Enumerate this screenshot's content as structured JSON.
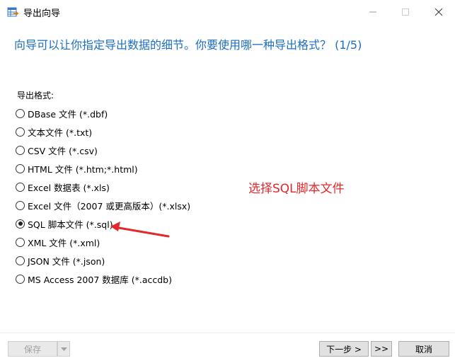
{
  "window": {
    "title": "导出向导",
    "controls": {
      "minimize_icon": "minimize-icon",
      "maximize_icon": "maximize-icon",
      "close_icon": "close-icon"
    }
  },
  "heading": "向导可以让你指定导出数据的细节。你要使用哪一种导出格式？ (1/5)",
  "format_label": "导出格式:",
  "formats": [
    {
      "label": "DBase 文件 (*.dbf)",
      "checked": false
    },
    {
      "label": "文本文件 (*.txt)",
      "checked": false
    },
    {
      "label": "CSV 文件 (*.csv)",
      "checked": false
    },
    {
      "label": "HTML 文件 (*.htm;*.html)",
      "checked": false
    },
    {
      "label": "Excel 数据表 (*.xls)",
      "checked": false
    },
    {
      "label": "Excel 文件（2007 或更高版本）(*.xlsx)",
      "checked": false
    },
    {
      "label": "SQL 脚本文件 (*.sql)",
      "checked": true
    },
    {
      "label": "XML 文件 (*.xml)",
      "checked": false
    },
    {
      "label": "JSON 文件 (*.json)",
      "checked": false
    },
    {
      "label": "MS Access 2007 数据库 (*.accdb)",
      "checked": false
    }
  ],
  "annotation": "选择SQL脚本文件",
  "buttons": {
    "save": "保存",
    "next": "下一步 >",
    "last": ">>",
    "cancel": "取消"
  },
  "colors": {
    "heading": "#1b6ec2",
    "annotation": "#e3272c"
  }
}
